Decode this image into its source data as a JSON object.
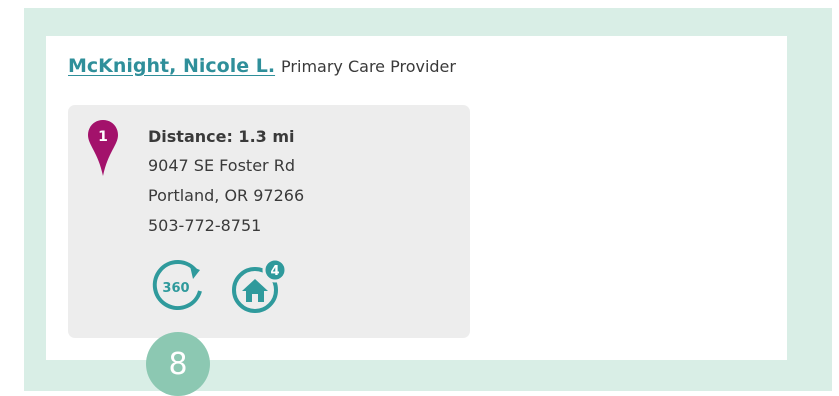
{
  "provider": {
    "name_link": "McKnight, Nicole L.",
    "role": "Primary Care Provider"
  },
  "location_card": {
    "marker_number": "1",
    "distance": "Distance: 1.3 mi",
    "street": "9047 SE Foster Rd",
    "city_state_zip": "Portland, OR 97266",
    "phone": "503-772-8751",
    "icons": {
      "tour": {
        "name": "360-tour-icon",
        "label": "360"
      },
      "home": {
        "name": "home-icon",
        "badge": "4"
      }
    }
  },
  "step_badge": "8",
  "colors": {
    "frame_background": "#d9eee6",
    "link": "#2f8f9a",
    "marker": "#a3126b",
    "card_background": "#ededed",
    "step_badge": "#8cc8b2"
  }
}
